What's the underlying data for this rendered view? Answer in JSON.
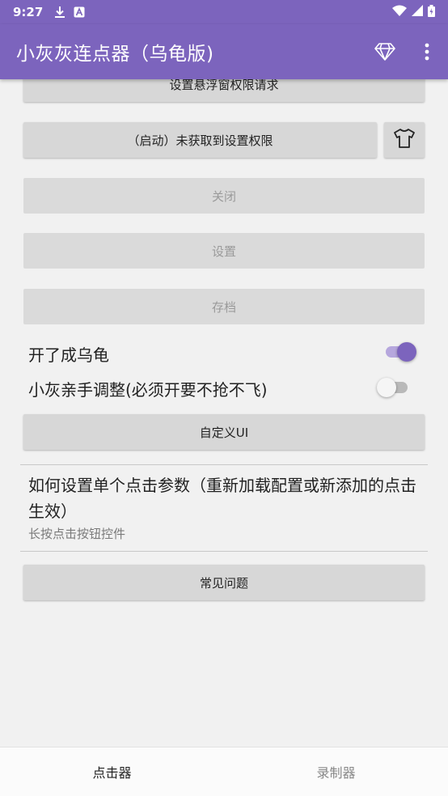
{
  "status_bar": {
    "time": "9:27"
  },
  "app_bar": {
    "title": "小灰灰连点器（乌龟版)"
  },
  "buttons": {
    "overlay_permission": "设置悬浮窗权限请求",
    "start": "（启动）未获取到设置权限",
    "close": "关闭",
    "settings": "设置",
    "save": "存档",
    "custom_ui": "自定义UI",
    "faq": "常见问题"
  },
  "switches": {
    "turtle_mode": {
      "label": "开了成乌龟",
      "on": true
    },
    "manual_adjust": {
      "label": "小灰亲手调整(必须开要不抢不飞)",
      "on": false
    }
  },
  "click_param_info": {
    "title": "如何设置单个点击参数（重新加载配置或新添加的点击生效）",
    "summary": "长按点击按钮控件"
  },
  "bottom_nav": {
    "items": [
      {
        "label": "点击器",
        "active": true
      },
      {
        "label": "录制器",
        "active": false
      }
    ]
  },
  "colors": {
    "primary": "#7c64bd",
    "switch_track_on": "#b6a7dd"
  }
}
